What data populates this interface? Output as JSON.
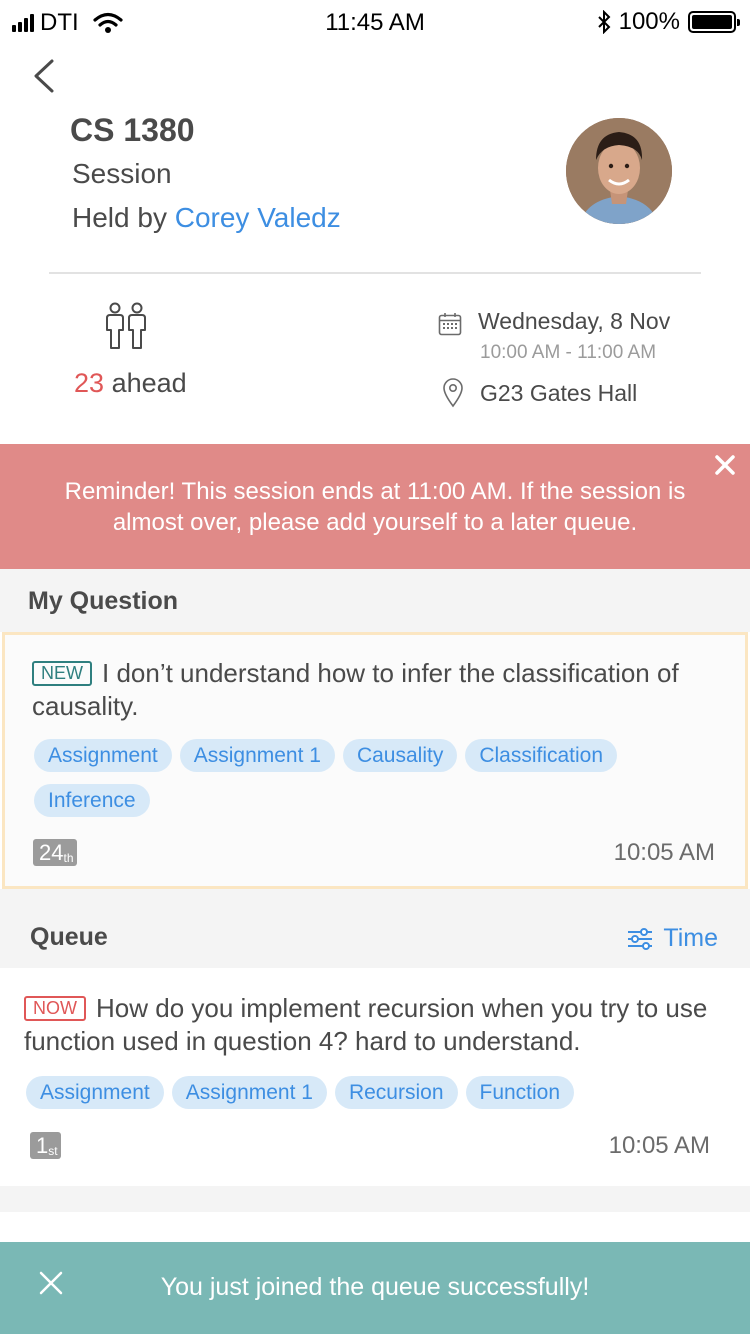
{
  "status_bar": {
    "carrier": "DTI",
    "time": "11:45 AM",
    "battery": "100%"
  },
  "header": {
    "course": "CS 1380",
    "session_type": "Session",
    "held_by_prefix": "Held by",
    "ta_name": "Corey Valedz"
  },
  "info": {
    "ahead_count": "23",
    "ahead_label": "ahead",
    "date": "Wednesday, 8 Nov",
    "time_range": "10:00 AM - 11:00 AM",
    "location": "G23 Gates Hall"
  },
  "reminder": {
    "line1": "Reminder! This session ends at 11:00 AM. If the session is",
    "line2": "almost over, please add yourself to a later queue."
  },
  "my_question": {
    "section_title": "My Question",
    "badge": "NEW",
    "text": "I don’t understand how to infer the classification of causality.",
    "tags": [
      "Assignment",
      "Assignment 1",
      "Causality",
      "Classification",
      "Inference"
    ],
    "rank_num": "24",
    "rank_suffix": "th",
    "time": "10:05 AM"
  },
  "queue": {
    "section_title": "Queue",
    "sort_label": "Time",
    "items": [
      {
        "badge": "NOW",
        "text": "How do you implement recursion when you try to use function used in question 4? hard to  understand.",
        "tags": [
          "Assignment",
          "Assignment 1",
          "Recursion",
          "Function"
        ],
        "rank_num": "1",
        "rank_suffix": "st",
        "time": "10:05 AM"
      }
    ]
  },
  "toast": {
    "message": "You just joined the queue successfully!"
  },
  "colors": {
    "link": "#3d8ee2",
    "alert": "#e05757",
    "reminder_bg": "#e08a88",
    "toast_bg": "#7ab8b5",
    "tag_bg": "#d7e9f8"
  }
}
